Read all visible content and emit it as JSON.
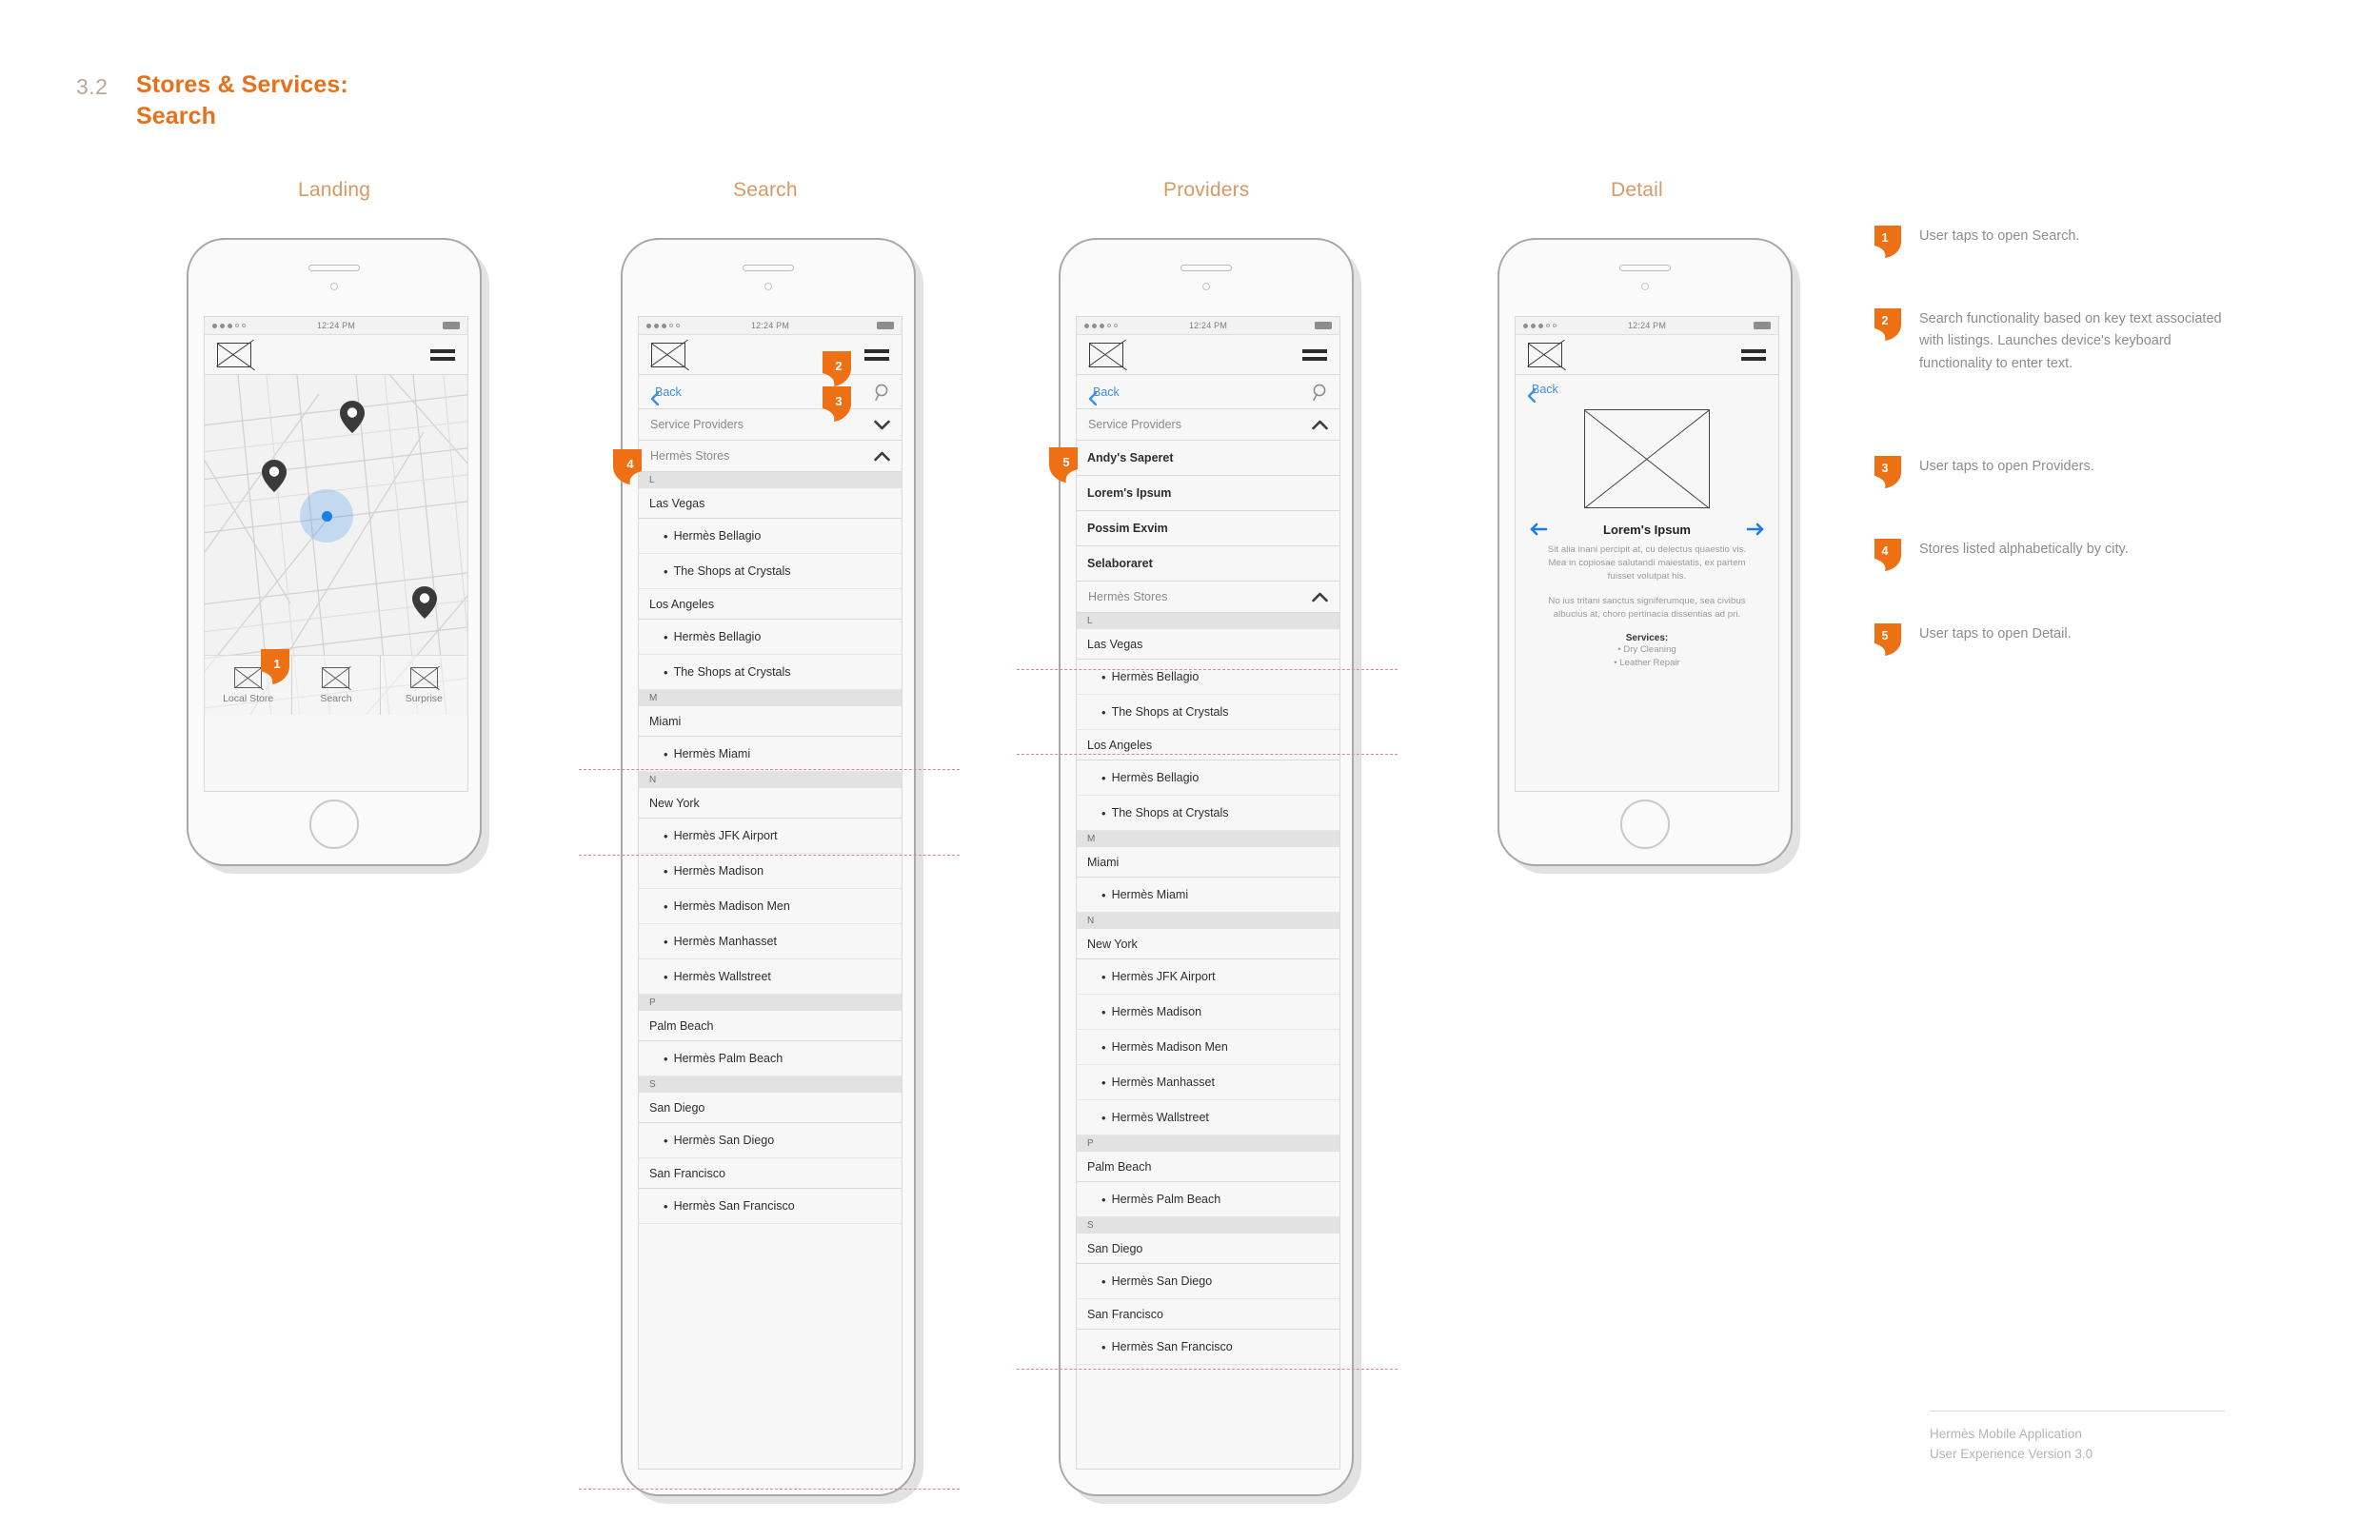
{
  "header": {
    "section_number": "3.2",
    "title_line1": "Stores & Services:",
    "title_line2": "Search"
  },
  "accent_colors": {
    "orange": "#ED7014",
    "title_orange": "#E8701A",
    "label_tan": "#D79A63",
    "link_blue": "#3F8FDD",
    "arrow_blue": "#1C7BE8",
    "guide_pink": "#D4889A",
    "pin_dark": "#3A3A3A",
    "user_dot_blue": "#1A7EE8"
  },
  "screens": [
    {
      "label": "Landing"
    },
    {
      "label": "Search"
    },
    {
      "label": "Providers"
    },
    {
      "label": "Detail"
    }
  ],
  "status_bar": {
    "time": "12:24 PM"
  },
  "nav": {
    "logo_icon": "placeholder-image-icon",
    "menu_icon": "hamburger-menu-icon",
    "back_label": "Back",
    "back_icon": "chevron-left-icon",
    "search_icon": "magnifier-icon"
  },
  "landing": {
    "map_icon": "map-view",
    "pins": [
      "map-pin-1",
      "map-pin-2",
      "map-pin-3"
    ],
    "user_location": "user-location-dot",
    "tabs": [
      {
        "label": "Local Store",
        "icon": "placeholder-image-icon"
      },
      {
        "label": "Search",
        "icon": "placeholder-image-icon"
      },
      {
        "label": "Surprise",
        "icon": "placeholder-image-icon"
      }
    ]
  },
  "search_screen": {
    "accordions": [
      {
        "label": "Service Providers",
        "state": "collapsed",
        "caret": "chevron-down-icon"
      },
      {
        "label": "Hermès Stores",
        "state": "expanded",
        "caret": "chevron-up-icon"
      }
    ],
    "groups": [
      {
        "letter": "L",
        "cities": [
          {
            "name": "Las Vegas",
            "stores": [
              "Hermès Bellagio",
              "The Shops at Crystals"
            ]
          },
          {
            "name": "Los Angeles",
            "stores": [
              "Hermès Bellagio",
              "The Shops at Crystals"
            ]
          }
        ]
      },
      {
        "letter": "M",
        "cities": [
          {
            "name": "Miami",
            "stores": [
              "Hermès Miami"
            ]
          }
        ]
      },
      {
        "letter": "N",
        "cities": [
          {
            "name": "New York",
            "stores": [
              "Hermès JFK Airport",
              "Hermès Madison",
              "Hermès Madison Men",
              "Hermès Manhasset",
              "Hermès Wallstreet"
            ]
          }
        ]
      },
      {
        "letter": "P",
        "cities": [
          {
            "name": "Palm Beach",
            "stores": [
              "Hermès Palm Beach"
            ]
          }
        ]
      },
      {
        "letter": "S",
        "cities": [
          {
            "name": "San Diego",
            "stores": [
              "Hermès San Diego"
            ]
          },
          {
            "name": "San Francisco",
            "stores": [
              "Hermès San Francisco"
            ]
          }
        ]
      }
    ]
  },
  "providers_screen": {
    "accordions": [
      {
        "label": "Service Providers",
        "state": "expanded",
        "caret": "chevron-up-icon"
      },
      {
        "label": "Hermès Stores",
        "state": "expanded",
        "caret": "chevron-up-icon"
      }
    ],
    "providers": [
      "Andy's Saperet",
      "Lorem's Ipsum",
      "Possim Exvim",
      "Selaboraret"
    ],
    "groups": [
      {
        "letter": "L",
        "cities": [
          {
            "name": "Las Vegas",
            "stores": [
              "Hermès Bellagio",
              "The Shops at Crystals"
            ]
          },
          {
            "name": "Los Angeles",
            "stores": [
              "Hermès Bellagio",
              "The Shops at Crystals"
            ]
          }
        ]
      },
      {
        "letter": "M",
        "cities": [
          {
            "name": "Miami",
            "stores": [
              "Hermès Miami"
            ]
          }
        ]
      },
      {
        "letter": "N",
        "cities": [
          {
            "name": "New York",
            "stores": [
              "Hermès JFK Airport",
              "Hermès Madison",
              "Hermès Madison Men",
              "Hermès Manhasset",
              "Hermès Wallstreet"
            ]
          }
        ]
      },
      {
        "letter": "P",
        "cities": [
          {
            "name": "Palm Beach",
            "stores": [
              "Hermès Palm Beach"
            ]
          }
        ]
      },
      {
        "letter": "S",
        "cities": [
          {
            "name": "San Diego",
            "stores": [
              "Hermès San Diego"
            ]
          },
          {
            "name": "San Francisco",
            "stores": [
              "Hermès San Francisco"
            ]
          }
        ]
      }
    ]
  },
  "detail_screen": {
    "back_label": "Back",
    "hero_image": "placeholder-image-icon",
    "prev_icon": "arrow-left-icon",
    "next_icon": "arrow-right-icon",
    "title": "Lorem's Ipsum",
    "paragraph_1": "Sit alia inani percipit at, cu delectus quaestio vis. Mea in copiosae salutandi maiestatis, ex partem fuisset volutpat his.",
    "paragraph_2": "No ius tritani sanctus signiferumque, sea civibus albucius at, choro pertinacia dissentias ad pri.",
    "services_heading": "Services:",
    "services": [
      "Dry Cleaning",
      "Leather Repair"
    ]
  },
  "callouts": [
    {
      "number": "1"
    },
    {
      "number": "2"
    },
    {
      "number": "3"
    },
    {
      "number": "4"
    },
    {
      "number": "5"
    }
  ],
  "legend": [
    {
      "number": "1",
      "text": "User taps to open Search."
    },
    {
      "number": "2",
      "text": "Search functionality based on key text associated with listings. Launches device's keyboard functionality to enter text."
    },
    {
      "number": "3",
      "text": "User taps to open Providers."
    },
    {
      "number": "4",
      "text": "Stores listed alphabetically by city."
    },
    {
      "number": "5",
      "text": "User taps to open Detail."
    }
  ],
  "footer": {
    "line1": "Hermès Mobile Application",
    "line2": "User Experience Version 3.0"
  }
}
